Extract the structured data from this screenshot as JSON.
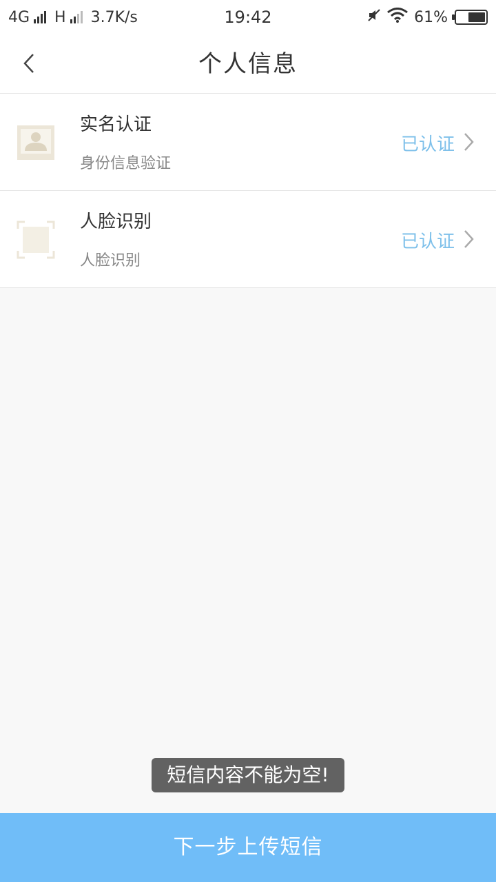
{
  "status_bar": {
    "network_4g": "4G",
    "network_h": "H",
    "speed": "3.7K/s",
    "time": "19:42",
    "battery_percent": "61%",
    "battery_level": 0.61
  },
  "nav": {
    "title": "个人信息"
  },
  "items": [
    {
      "title": "实名认证",
      "subtitle": "身份信息验证",
      "status": "已认证",
      "icon": "id-card-icon"
    },
    {
      "title": "人脸识别",
      "subtitle": "人脸识别",
      "status": "已认证",
      "icon": "face-scan-icon"
    }
  ],
  "toast": {
    "message": "短信内容不能为空!"
  },
  "footer": {
    "next_label": "下一步上传短信"
  },
  "colors": {
    "accent": "#70bdf8",
    "status_text": "#7ec0ea",
    "icon_tint": "#ece6d8"
  }
}
